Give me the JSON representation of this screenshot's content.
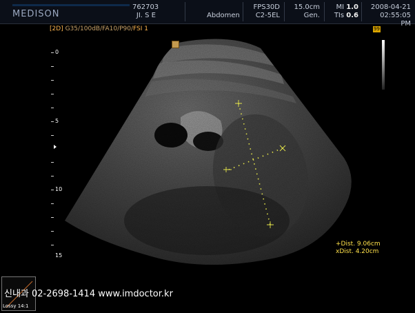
{
  "header": {
    "brand": "MEDISON",
    "patient_id": "762703",
    "patient_name": "JI. S E",
    "exam": "Abdomen",
    "preset": "FPS30D",
    "probe": "C2-5EL",
    "depth": "15.0cm",
    "gen": "Gen.",
    "mi_label": "MI",
    "mi_value": "1.0",
    "tis_label": "TIs",
    "tis_value": "0.6",
    "date": "2008-04-21",
    "time": "02:55:05 PM"
  },
  "params": {
    "mode": "[2D]",
    "settings": "G35/100dB/FA10/P90/",
    "fsi": "FSI 1"
  },
  "zoom_badge": "99",
  "depth_scale": {
    "labels": [
      "0",
      "5",
      "10",
      "15"
    ]
  },
  "measurements": {
    "dist_plus": "+Dist. 9.06cm",
    "dist_x": "xDist. 4.20cm"
  },
  "footer": {
    "clinic": "신내과 02-2698-1414   www.imdoctor.kr",
    "lossy": "Lossy 14:1"
  }
}
